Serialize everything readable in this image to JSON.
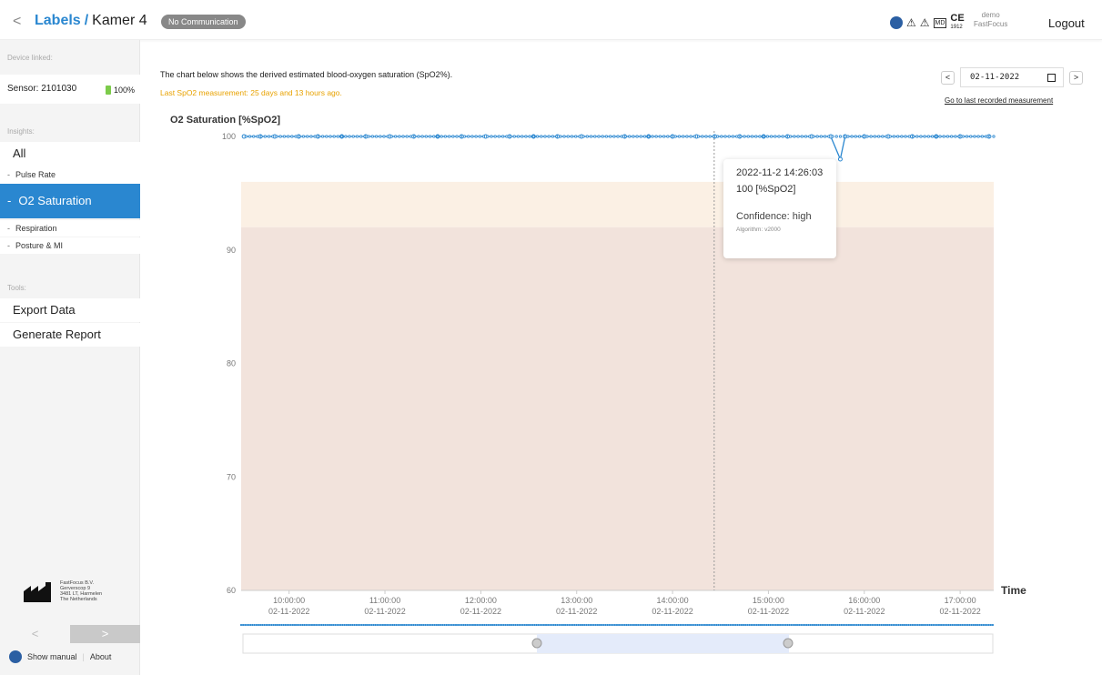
{
  "header": {
    "back_label": "<",
    "breadcrumb_link": "Labels",
    "breadcrumb_sep": "/",
    "breadcrumb_current": "Kamer 4",
    "status_badge": "No Communication",
    "user_name": "demo",
    "user_org": "FastFocus",
    "ce_mark": "CE",
    "ce_number": "1912",
    "md_label": "MD",
    "logout": "Logout"
  },
  "sidebar": {
    "device_linked_label": "Device linked:",
    "sensor": "Sensor: 2101030",
    "battery": "100%",
    "insights_label": "Insights:",
    "items": [
      {
        "label": "All"
      },
      {
        "label": "Pulse Rate"
      },
      {
        "label": "O2 Saturation"
      },
      {
        "label": "Respiration"
      },
      {
        "label": "Posture & MI"
      }
    ],
    "tools_label": "Tools:",
    "tools": [
      {
        "label": "Export Data"
      },
      {
        "label": "Generate Report"
      }
    ],
    "company": [
      "FastFocus B.V.",
      "Gerverscop 9",
      "3481 LT, Harmelen",
      "The Netherlands"
    ],
    "prev": "<",
    "next": ">",
    "show_manual": "Show manual",
    "link_sep": "|",
    "about": "About"
  },
  "main": {
    "intro": "The chart below shows the derived estimated blood-oxygen saturation (SpO2%).",
    "last_measurement": "Last SpO2 measurement: 25 days and 13 hours ago.",
    "date_prev": "<",
    "date_value": "02-11-2022",
    "date_next": ">",
    "go_last": "Go to last recorded measurement"
  },
  "tooltip": {
    "datetime": "2022-11-2 14:26:03",
    "value": "100 [%SpO2]",
    "confidence": "Confidence: high",
    "algorithm": "Algorithm: v2000"
  },
  "chart_data": {
    "type": "line",
    "title": "O2 Saturation [%SpO2]",
    "xlabel": "Time",
    "ylabel": "",
    "ylim": [
      60,
      100
    ],
    "yticks": [
      100,
      90,
      80,
      70,
      60
    ],
    "xticks": [
      {
        "time": "10:00:00",
        "date": "02-11-2022"
      },
      {
        "time": "11:00:00",
        "date": "02-11-2022"
      },
      {
        "time": "12:00:00",
        "date": "02-11-2022"
      },
      {
        "time": "13:00:00",
        "date": "02-11-2022"
      },
      {
        "time": "14:00:00",
        "date": "02-11-2022"
      },
      {
        "time": "15:00:00",
        "date": "02-11-2022"
      },
      {
        "time": "16:00:00",
        "date": "02-11-2022"
      },
      {
        "time": "17:00:00",
        "date": "02-11-2022"
      }
    ],
    "x_range_hours": [
      9.5,
      17.35
    ],
    "bands": [
      {
        "from": 96,
        "to": 92,
        "color": "#fbf0e4"
      },
      {
        "from": 92,
        "to": 60,
        "color": "#f2e3dc"
      }
    ],
    "series": [
      {
        "color": "#2a87d0",
        "points": [
          [
            9.53,
            100
          ],
          [
            9.7,
            100
          ],
          [
            9.85,
            100
          ],
          [
            10.1,
            100
          ],
          [
            10.3,
            100
          ],
          [
            10.55,
            100
          ],
          [
            10.8,
            100
          ],
          [
            11.05,
            100
          ],
          [
            11.3,
            100
          ],
          [
            11.55,
            100
          ],
          [
            11.8,
            100
          ],
          [
            12.05,
            100
          ],
          [
            12.3,
            100
          ],
          [
            12.55,
            100
          ],
          [
            12.8,
            100
          ],
          [
            13.05,
            100
          ],
          [
            13.5,
            100
          ],
          [
            13.75,
            100
          ],
          [
            14.0,
            100
          ],
          [
            14.25,
            100
          ],
          [
            14.44,
            100
          ],
          [
            14.7,
            100
          ],
          [
            14.95,
            100
          ],
          [
            15.2,
            100
          ],
          [
            15.45,
            100
          ],
          [
            15.65,
            100
          ],
          [
            15.75,
            98
          ],
          [
            15.8,
            100
          ],
          [
            16.0,
            100
          ],
          [
            16.25,
            100
          ],
          [
            16.5,
            100
          ],
          [
            16.75,
            100
          ],
          [
            17.0,
            100
          ],
          [
            17.3,
            100
          ]
        ]
      }
    ],
    "hover_time": "14:26:03",
    "grid": false,
    "legend": "none"
  }
}
